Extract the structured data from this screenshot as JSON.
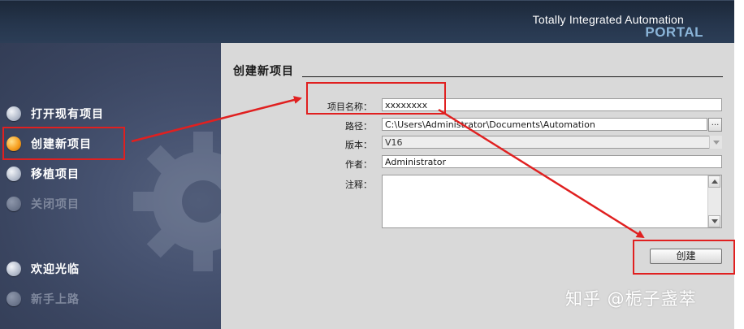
{
  "header": {
    "title_line1": "Totally Integrated Automation",
    "title_line2": "PORTAL"
  },
  "nav": {
    "items": [
      {
        "label": "打开现有项目",
        "state": "normal"
      },
      {
        "label": "创建新项目",
        "state": "active"
      },
      {
        "label": "移植项目",
        "state": "normal"
      },
      {
        "label": "关闭项目",
        "state": "disabled"
      },
      {
        "label": "欢迎光临",
        "state": "normal"
      },
      {
        "label": "新手上路",
        "state": "disabled"
      }
    ]
  },
  "form": {
    "section_title": "创建新项目",
    "project_name_label": "项目名称：",
    "project_name_value": "xxxxxxxx",
    "path_label": "路径：",
    "path_value": "C:\\Users\\Administrator\\Documents\\Automation",
    "browse_label": "...",
    "version_label": "版本：",
    "version_value": "V16",
    "author_label": "作者：",
    "author_value": "Administrator",
    "comment_label": "注释：",
    "comment_value": "",
    "create_button": "创建"
  },
  "watermark": "知乎 @栀子盏萃",
  "colors": {
    "annotation": "#e02020",
    "active_bullet": "#f7a021",
    "portal_text": "#8ab4d8"
  }
}
